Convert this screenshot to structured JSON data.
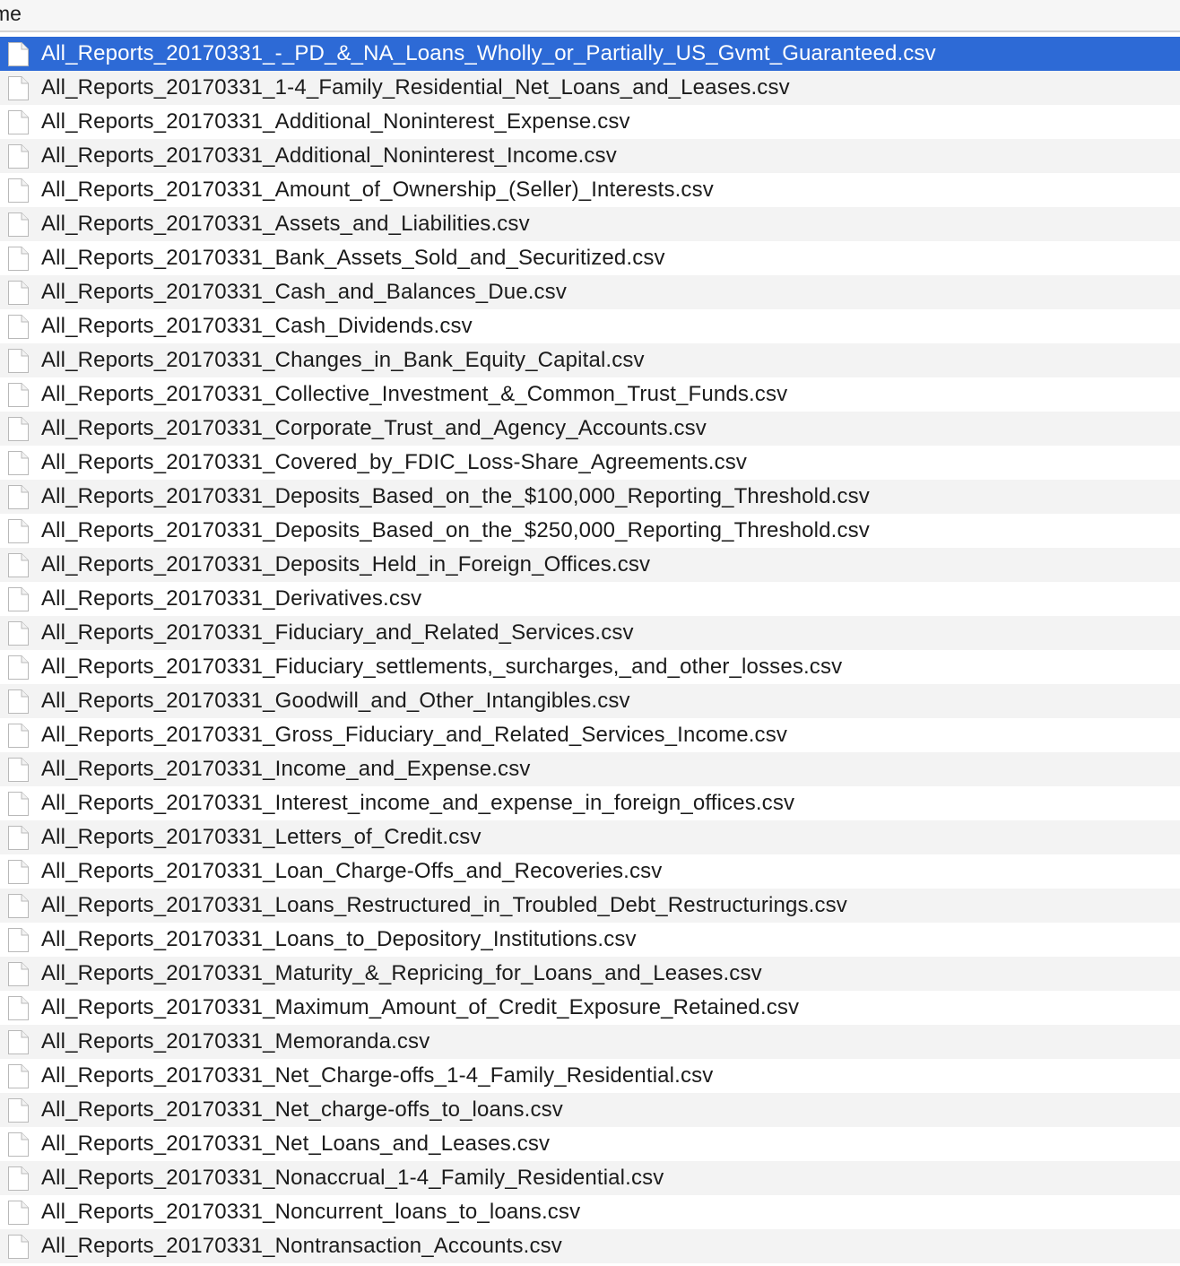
{
  "header": {
    "column_label": "me"
  },
  "icon": "document-file-icon",
  "colors": {
    "selection": "#2d6ad6",
    "row_alt": "#f3f3f3",
    "header_bg": "#f6f6f6"
  },
  "selected_index": 0,
  "files": [
    "All_Reports_20170331_-_PD_&_NA_Loans_Wholly_or_Partially_US_Gvmt_Guaranteed.csv",
    "All_Reports_20170331_1-4_Family_Residential_Net_Loans_and_Leases.csv",
    "All_Reports_20170331_Additional_Noninterest_Expense.csv",
    "All_Reports_20170331_Additional_Noninterest_Income.csv",
    "All_Reports_20170331_Amount_of_Ownership_(Seller)_Interests.csv",
    "All_Reports_20170331_Assets_and_Liabilities.csv",
    "All_Reports_20170331_Bank_Assets_Sold_and_Securitized.csv",
    "All_Reports_20170331_Cash_and_Balances_Due.csv",
    "All_Reports_20170331_Cash_Dividends.csv",
    "All_Reports_20170331_Changes_in_Bank_Equity_Capital.csv",
    "All_Reports_20170331_Collective_Investment_&_Common_Trust_Funds.csv",
    "All_Reports_20170331_Corporate_Trust_and_Agency_Accounts.csv",
    "All_Reports_20170331_Covered_by_FDIC_Loss-Share_Agreements.csv",
    "All_Reports_20170331_Deposits_Based_on_the_$100,000_Reporting_Threshold.csv",
    "All_Reports_20170331_Deposits_Based_on_the_$250,000_Reporting_Threshold.csv",
    "All_Reports_20170331_Deposits_Held_in_Foreign_Offices.csv",
    "All_Reports_20170331_Derivatives.csv",
    "All_Reports_20170331_Fiduciary_and_Related_Services.csv",
    "All_Reports_20170331_Fiduciary_settlements,_surcharges,_and_other_losses.csv",
    "All_Reports_20170331_Goodwill_and_Other_Intangibles.csv",
    "All_Reports_20170331_Gross_Fiduciary_and_Related_Services_Income.csv",
    "All_Reports_20170331_Income_and_Expense.csv",
    "All_Reports_20170331_Interest_income_and_expense_in_foreign_offices.csv",
    "All_Reports_20170331_Letters_of_Credit.csv",
    "All_Reports_20170331_Loan_Charge-Offs_and_Recoveries.csv",
    "All_Reports_20170331_Loans_Restructured_in_Troubled_Debt_Restructurings.csv",
    "All_Reports_20170331_Loans_to_Depository_Institutions.csv",
    "All_Reports_20170331_Maturity_&_Repricing_for_Loans_and_Leases.csv",
    "All_Reports_20170331_Maximum_Amount_of_Credit_Exposure_Retained.csv",
    "All_Reports_20170331_Memoranda.csv",
    "All_Reports_20170331_Net_Charge-offs_1-4_Family_Residential.csv",
    "All_Reports_20170331_Net_charge-offs_to_loans.csv",
    "All_Reports_20170331_Net_Loans_and_Leases.csv",
    "All_Reports_20170331_Nonaccrual_1-4_Family_Residential.csv",
    "All_Reports_20170331_Noncurrent_loans_to_loans.csv",
    "All_Reports_20170331_Nontransaction_Accounts.csv"
  ]
}
